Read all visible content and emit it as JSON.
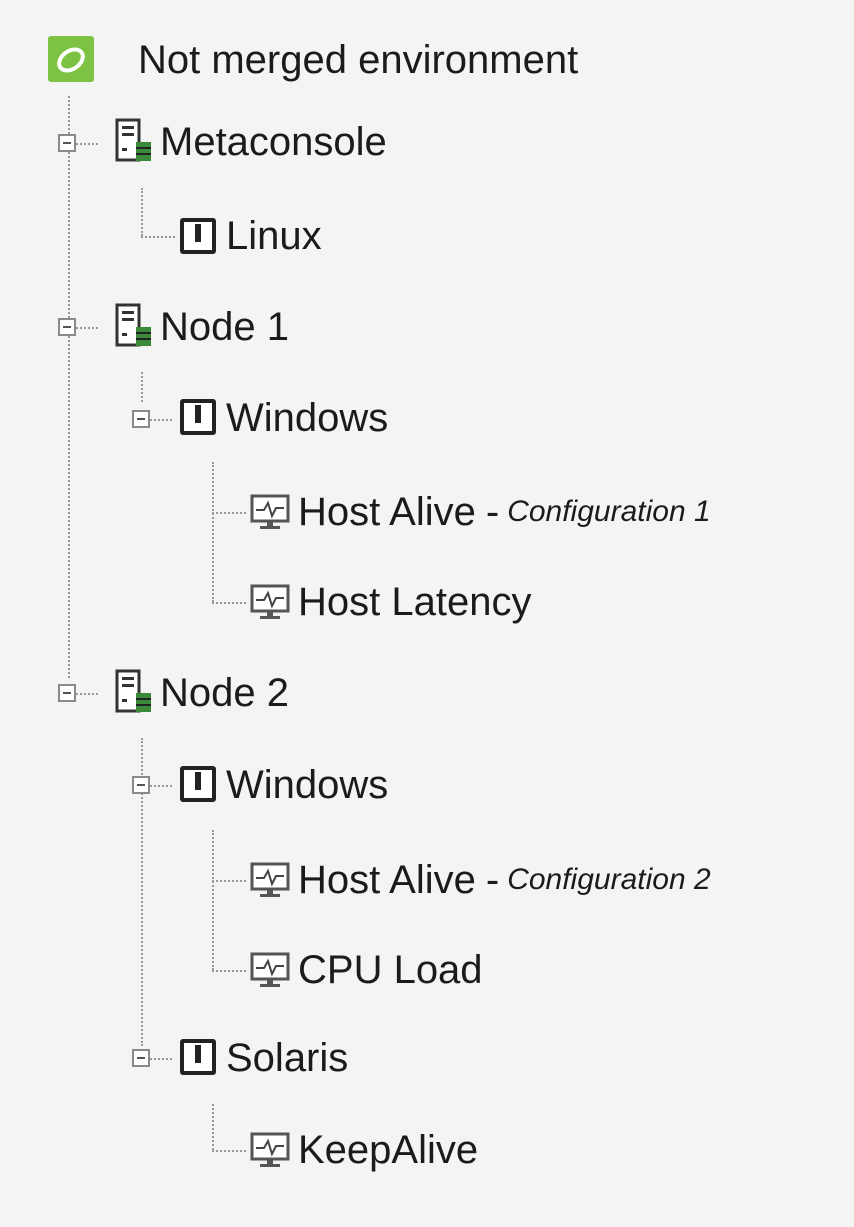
{
  "root": {
    "label": "Not merged environment",
    "icon": "root-environment-icon",
    "icon_color": "#7dc242"
  },
  "nodes": [
    {
      "label": "Metaconsole",
      "icon": "server-icon",
      "children": [
        {
          "label": "Linux",
          "icon": "module-icon",
          "children": []
        }
      ]
    },
    {
      "label": "Node 1",
      "icon": "server-icon",
      "children": [
        {
          "label": "Windows",
          "icon": "module-icon",
          "children": [
            {
              "label": "Host Alive",
              "suffix": "Configuration 1",
              "icon": "monitor-icon"
            },
            {
              "label": "Host Latency",
              "icon": "monitor-icon"
            }
          ]
        }
      ]
    },
    {
      "label": "Node 2",
      "icon": "server-icon",
      "children": [
        {
          "label": "Windows",
          "icon": "module-icon",
          "children": [
            {
              "label": "Host Alive",
              "suffix": "Configuration 2",
              "icon": "monitor-icon"
            },
            {
              "label": "CPU Load",
              "icon": "monitor-icon"
            }
          ]
        },
        {
          "label": "Solaris",
          "icon": "module-icon",
          "children": [
            {
              "label": "KeepAlive",
              "icon": "monitor-icon"
            }
          ]
        }
      ]
    }
  ],
  "separator": "-",
  "colors": {
    "background": "#f4f4f4",
    "tree_line": "#9a9a9a",
    "agent_status": "#3a8a3a",
    "monitor_pulse": "#444444"
  }
}
